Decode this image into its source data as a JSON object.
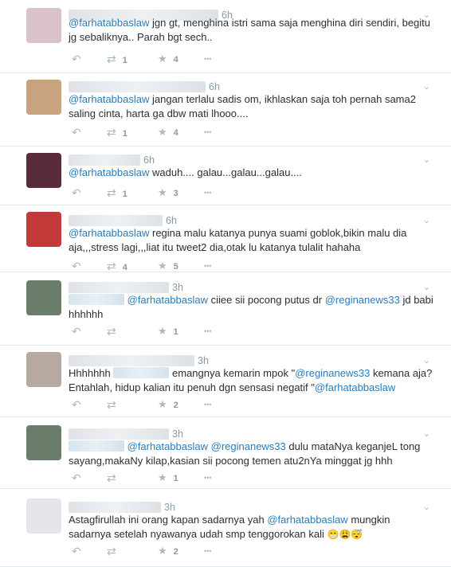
{
  "tweets": [
    {
      "time": "6h",
      "parts": [
        {
          "m": "@farhatabbaslaw"
        },
        {
          "t": " jgn gt, menghina istri sama saja menghina diri sendiri, begitu jg sebaliknya.. Parah bgt sech.."
        }
      ],
      "retweets": "1",
      "favorites": "4",
      "avatar_color": "#d9c2c8"
    },
    {
      "time": "6h",
      "parts": [
        {
          "m": "@farhatabbaslaw"
        },
        {
          "t": " jangan terlalu sadis om, ikhlaskan saja toh pernah sama2 saling cinta, harta ga dbw mati lhooo...."
        }
      ],
      "retweets": "1",
      "favorites": "4",
      "avatar_color": "#c9a27f"
    },
    {
      "time": "6h",
      "parts": [
        {
          "m": "@farhatabbaslaw"
        },
        {
          "t": " waduh.... galau...galau...galau...."
        }
      ],
      "retweets": "1",
      "favorites": "3",
      "avatar_color": "#5a2b3a"
    },
    {
      "time": "6h",
      "parts": [
        {
          "m": "@farhatabbaslaw"
        },
        {
          "t": " regina malu katanya punya suami goblok,bikin malu dia aja,,,stress lagi,,,liat itu tweet2 dia,otak lu katanya tulalit hahaha"
        }
      ],
      "retweets": "4",
      "favorites": "5",
      "avatar_color": "#c23a3a"
    },
    {
      "time": "3h",
      "parts": [
        {
          "h": true
        },
        {
          "t": " "
        },
        {
          "m": "@farhatabbaslaw"
        },
        {
          "t": " ciiee sii pocong putus dr "
        },
        {
          "m": "@reginanews33"
        },
        {
          "t": " jd babi hhhhhh"
        }
      ],
      "retweets": "",
      "favorites": "1",
      "avatar_color": "#6a7d6a"
    },
    {
      "time": "3h",
      "parts": [
        {
          "t": "Hhhhhhh "
        },
        {
          "h": true
        },
        {
          "t": " emangnya kemarin mpok \""
        },
        {
          "m": "@reginanews33"
        },
        {
          "t": " kemana aja? Entahlah, hidup kalian itu penuh dgn sensasi negatif \""
        },
        {
          "m": "@farhatabbaslaw"
        }
      ],
      "retweets": "",
      "favorites": "2",
      "avatar_color": "#b7a9a0"
    },
    {
      "time": "3h",
      "parts": [
        {
          "h": true
        },
        {
          "t": " "
        },
        {
          "m": "@farhatabbaslaw"
        },
        {
          "t": " "
        },
        {
          "m": "@reginanews33"
        },
        {
          "t": " dulu mataNya keganjeL tong sayang,makaNy kilap,kasian sii pocong temen atu2nYa minggat jg hhh"
        }
      ],
      "retweets": "",
      "favorites": "1",
      "avatar_color": "#6a7d6a"
    },
    {
      "time": "3h",
      "parts": [
        {
          "t": "Astagfirullah ini orang kapan sadarnya yah "
        },
        {
          "m": "@farhatabbaslaw"
        },
        {
          "t": " mungkin sadarnya setelah nyawanya udah smp tenggorokan kali "
        }
      ],
      "emojis": [
        "😁",
        "😩",
        "😴"
      ],
      "retweets": "",
      "favorites": "2",
      "avatar_color": "#e6e6ea"
    }
  ]
}
